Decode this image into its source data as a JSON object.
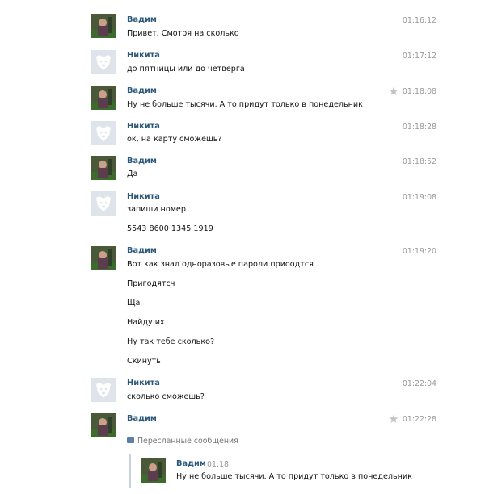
{
  "messages": [
    {
      "sender": "Вадим",
      "time": "01:16:12",
      "starred": false,
      "lines": [
        "Привет. Смотря на сколько"
      ]
    },
    {
      "sender": "Никита",
      "time": "01:17:12",
      "starred": false,
      "lines": [
        "до пятницы или до четверга"
      ]
    },
    {
      "sender": "Вадим",
      "time": "01:18:08",
      "starred": true,
      "lines": [
        "Ну не больше тысячи. А то придут только в понедельник"
      ]
    },
    {
      "sender": "Никита",
      "time": "01:18:28",
      "starred": false,
      "lines": [
        "ок, на карту сможешь?"
      ]
    },
    {
      "sender": "Вадим",
      "time": "01:18:52",
      "starred": false,
      "lines": [
        "Да"
      ]
    },
    {
      "sender": "Никита",
      "time": "01:19:08",
      "starred": false,
      "lines": [
        "запиши номер",
        "5543 8600 1345 1919"
      ]
    },
    {
      "sender": "Вадим",
      "time": "01:19:20",
      "starred": false,
      "lines": [
        "Вот как знал одноразовые пароли приоодтся",
        "Пригодятсч",
        "Ща",
        "Найду их",
        "Ну так тебе сколько?",
        "Скинуть"
      ]
    },
    {
      "sender": "Никита",
      "time": "01:22:04",
      "starred": false,
      "lines": [
        "сколько сможешь?"
      ]
    },
    {
      "sender": "Вадим",
      "time": "01:22:28",
      "starred": true,
      "lines": []
    }
  ],
  "forwarded": {
    "label": "Пересланные сообщения",
    "sender": "Вадим",
    "time": "01:18",
    "text": "Ну не больше тысячи. А то придут только в понедельник"
  },
  "colors": {
    "name": "#2b587a",
    "time": "#999999",
    "star": "#c4c4c4"
  },
  "icons": {
    "star": "star-icon",
    "forward": "forwarded-messages-icon"
  }
}
